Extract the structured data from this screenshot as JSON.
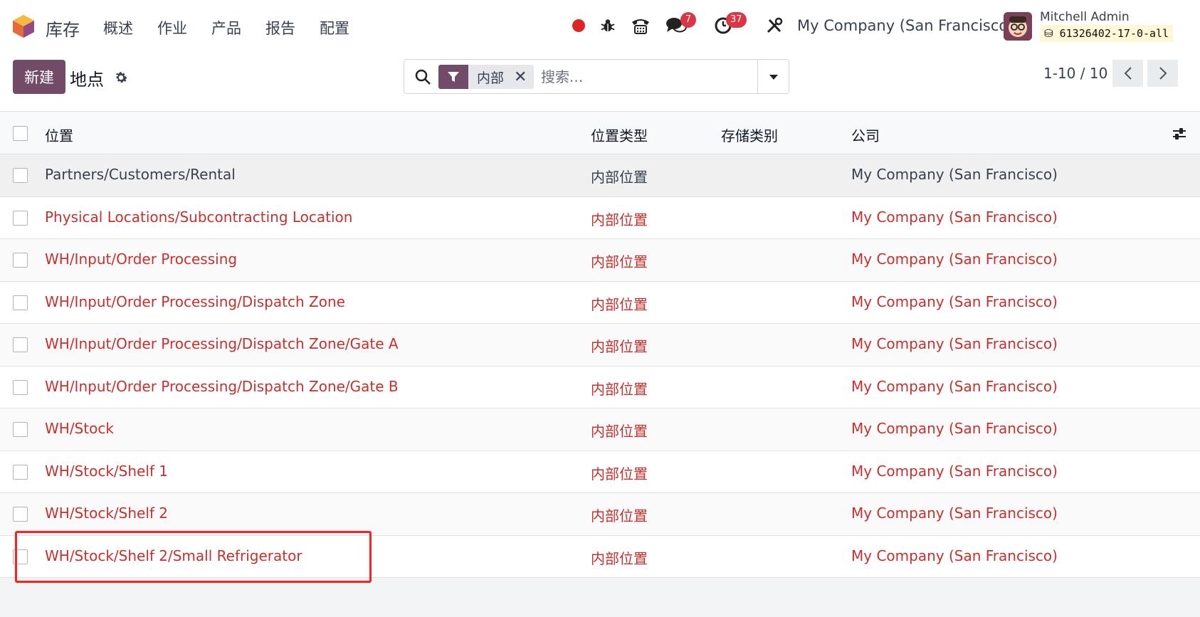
{
  "app": {
    "name": "库存"
  },
  "menu": [
    "概述",
    "作业",
    "产品",
    "报告",
    "配置"
  ],
  "systray": {
    "messages_count": "7",
    "activities_count": "37",
    "company": "My Company (San Francisco)",
    "user_name": "Mitchell Admin",
    "db_name": "61326402-17-0-all"
  },
  "control": {
    "new_label": "新建",
    "breadcrumb": "地点",
    "facet_label": "内部",
    "search_placeholder": "搜索...",
    "pager_value": "1-10 / 10"
  },
  "table": {
    "headers": [
      "位置",
      "位置类型",
      "存储类别",
      "公司"
    ],
    "rows": [
      {
        "location": "Partners/Customers/Rental",
        "type": "内部位置",
        "storage": "",
        "company": "My Company (San Francisco)"
      },
      {
        "location": "Physical Locations/Subcontracting Location",
        "type": "内部位置",
        "storage": "",
        "company": "My Company (San Francisco)"
      },
      {
        "location": "WH/Input/Order Processing",
        "type": "内部位置",
        "storage": "",
        "company": "My Company (San Francisco)"
      },
      {
        "location": "WH/Input/Order Processing/Dispatch Zone",
        "type": "内部位置",
        "storage": "",
        "company": "My Company (San Francisco)"
      },
      {
        "location": "WH/Input/Order Processing/Dispatch Zone/Gate A",
        "type": "内部位置",
        "storage": "",
        "company": "My Company (San Francisco)"
      },
      {
        "location": "WH/Input/Order Processing/Dispatch Zone/Gate B",
        "type": "内部位置",
        "storage": "",
        "company": "My Company (San Francisco)"
      },
      {
        "location": "WH/Stock",
        "type": "内部位置",
        "storage": "",
        "company": "My Company (San Francisco)"
      },
      {
        "location": "WH/Stock/Shelf 1",
        "type": "内部位置",
        "storage": "",
        "company": "My Company (San Francisco)"
      },
      {
        "location": "WH/Stock/Shelf 2",
        "type": "内部位置",
        "storage": "",
        "company": "My Company (San Francisco)"
      },
      {
        "location": "WH/Stock/Shelf 2/Small Refrigerator",
        "type": "内部位置",
        "storage": "",
        "company": "My Company (San Francisco)"
      }
    ]
  },
  "colors": {
    "brand": "#714b67",
    "archived_text": "#c9302c",
    "annotation": "#ff1f1f"
  }
}
